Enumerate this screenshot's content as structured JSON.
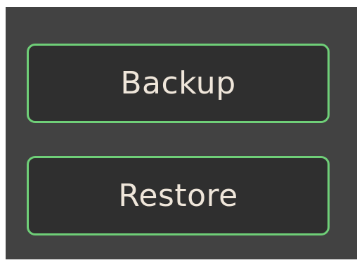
{
  "actions": {
    "backup_label": "Backup",
    "restore_label": "Restore"
  },
  "colors": {
    "panel_background": "#424242",
    "button_background": "#2f2f2f",
    "button_border": "#6fcf78",
    "button_text": "#efe6da"
  }
}
